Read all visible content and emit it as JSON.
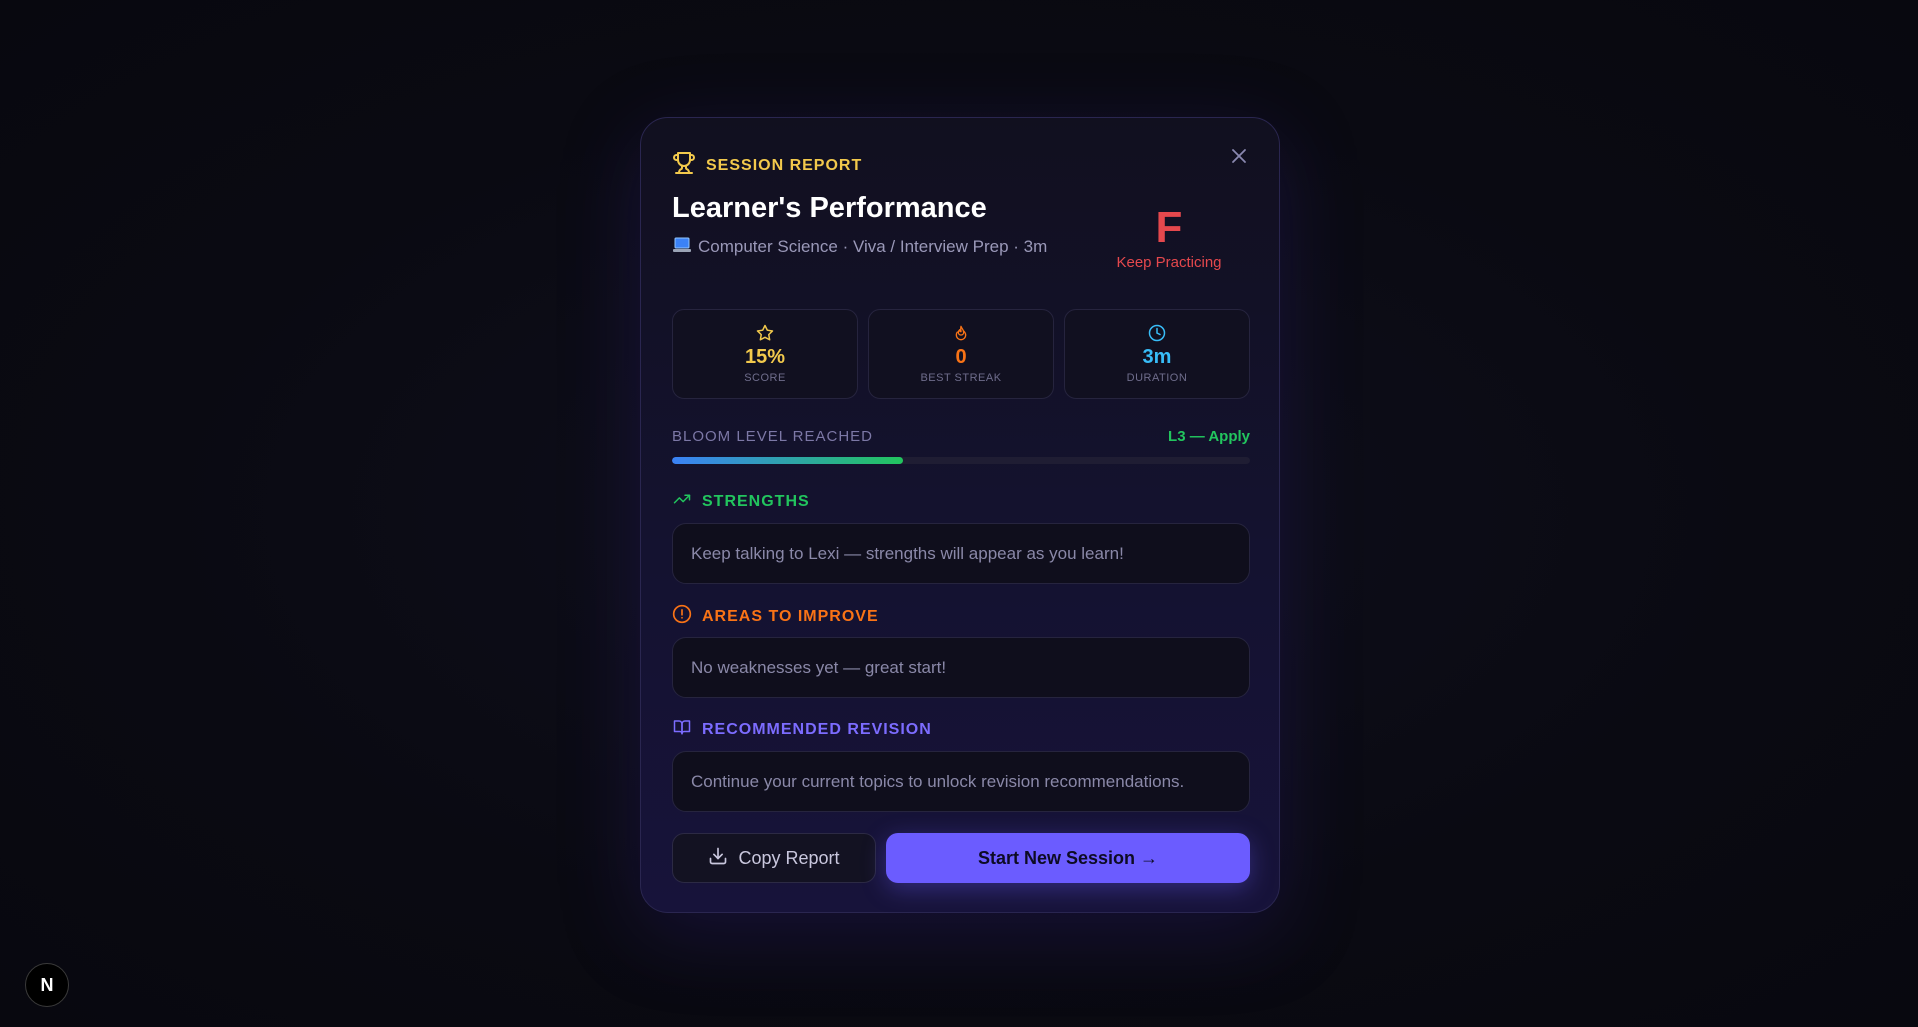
{
  "report": {
    "eyebrow": "SESSION REPORT",
    "title": "Learner's Performance",
    "subtitle": "Computer Science · Viva / Interview Prep · 3m",
    "grade": "F",
    "grade_label": "Keep Practicing"
  },
  "stats": [
    {
      "icon": "star-icon",
      "value": "15%",
      "label": "SCORE",
      "color": "#f2c94c"
    },
    {
      "icon": "flame-icon",
      "value": "0",
      "label": "BEST STREAK",
      "color": "#f97316"
    },
    {
      "icon": "clock-icon",
      "value": "3m",
      "label": "DURATION",
      "color": "#38bdf8"
    }
  ],
  "bloom": {
    "label": "BLOOM LEVEL REACHED",
    "value": "L3 — Apply",
    "progress": 0.4
  },
  "sections": {
    "strengths": {
      "title": "STRENGTHS",
      "text": "Keep talking to Lexi — strengths will appear as you learn!",
      "color": "#22c55e"
    },
    "improve": {
      "title": "AREAS TO IMPROVE",
      "text": "No weaknesses yet — great start!",
      "color": "#f97316"
    },
    "revision": {
      "title": "RECOMMENDED REVISION",
      "text": "Continue your current topics to unlock revision recommendations.",
      "color": "#7c6cff"
    }
  },
  "actions": {
    "copy_label": "Copy Report",
    "start_label": "Start New Session →"
  },
  "badge": {
    "letter": "N"
  }
}
